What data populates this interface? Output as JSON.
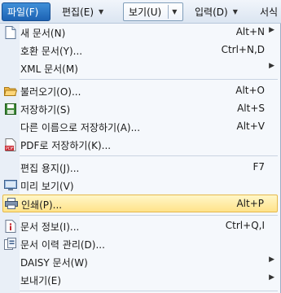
{
  "menubar": {
    "file": "파일(F)",
    "edit": "편집(E)",
    "view": "보기(U)",
    "input": "입력(D)",
    "format": "서식"
  },
  "menu": {
    "new_doc": {
      "label": "새 문서(N)",
      "shortcut": "Alt+N",
      "icon": "new-document-icon"
    },
    "compat_doc": {
      "label": "호환 문서(Y)...",
      "shortcut": "Ctrl+N,D"
    },
    "xml_doc": {
      "label": "XML 문서(M)",
      "shortcut": ""
    },
    "open": {
      "label": "불러오기(O)...",
      "shortcut": "Alt+O",
      "icon": "folder-open-icon"
    },
    "save": {
      "label": "저장하기(S)",
      "shortcut": "Alt+S",
      "icon": "save-disk-icon"
    },
    "save_as": {
      "label": "다른 이름으로 저장하기(A)...",
      "shortcut": "Alt+V"
    },
    "save_pdf": {
      "label": "PDF로 저장하기(K)...",
      "shortcut": "",
      "icon": "pdf-icon"
    },
    "page_setup": {
      "label": "편집 용지(J)...",
      "shortcut": "F7"
    },
    "preview": {
      "label": "미리 보기(V)",
      "shortcut": "",
      "icon": "preview-monitor-icon"
    },
    "print": {
      "label": "인쇄(P)...",
      "shortcut": "Alt+P",
      "icon": "printer-icon"
    },
    "doc_info": {
      "label": "문서 정보(I)...",
      "shortcut": "Ctrl+Q,I",
      "icon": "document-info-icon"
    },
    "doc_history": {
      "label": "문서 이력 관리(D)...",
      "shortcut": "",
      "icon": "document-history-icon"
    },
    "daisy": {
      "label": "DAISY 문서(W)",
      "shortcut": ""
    },
    "send": {
      "label": "보내기(E)",
      "shortcut": ""
    }
  }
}
